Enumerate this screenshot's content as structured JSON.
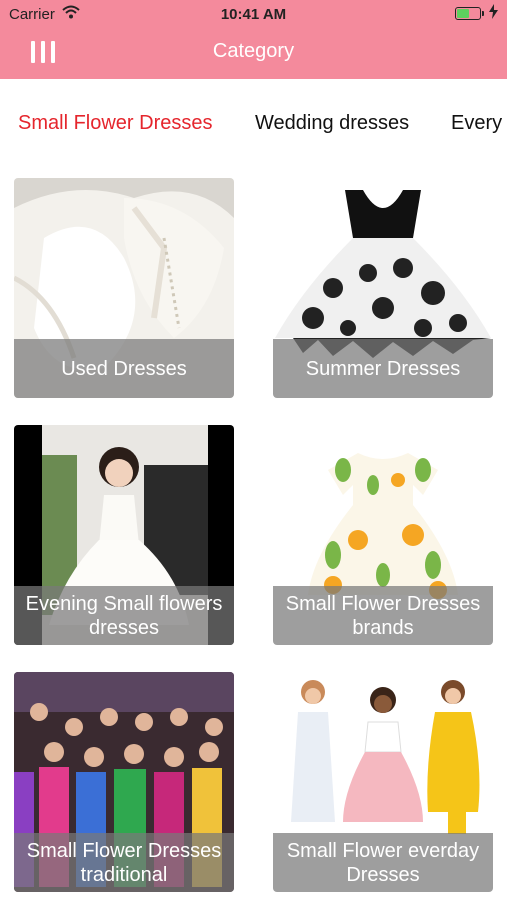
{
  "status_bar": {
    "carrier": "Carrier",
    "time": "10:41 AM",
    "wifi_icon": "wifi-icon",
    "battery_icon": "battery-icon",
    "charging_icon": "bolt-icon"
  },
  "nav": {
    "title": "Category",
    "menu_icon": "menu-bars-icon",
    "background": "#f48a9c"
  },
  "tabs": [
    {
      "label": "Small Flower Dresses",
      "active": true
    },
    {
      "label": "Wedding dresses",
      "active": false
    },
    {
      "label": "Every",
      "active": false
    }
  ],
  "accent_color": "#e5262d",
  "cards": [
    {
      "caption": "Used Dresses"
    },
    {
      "caption": "Summer Dresses"
    },
    {
      "caption": "Evening Small flowers dresses"
    },
    {
      "caption": "Small Flower Dresses brands"
    },
    {
      "caption": "Small Flower Dresses traditional"
    },
    {
      "caption": "Small Flower everday Dresses"
    }
  ]
}
